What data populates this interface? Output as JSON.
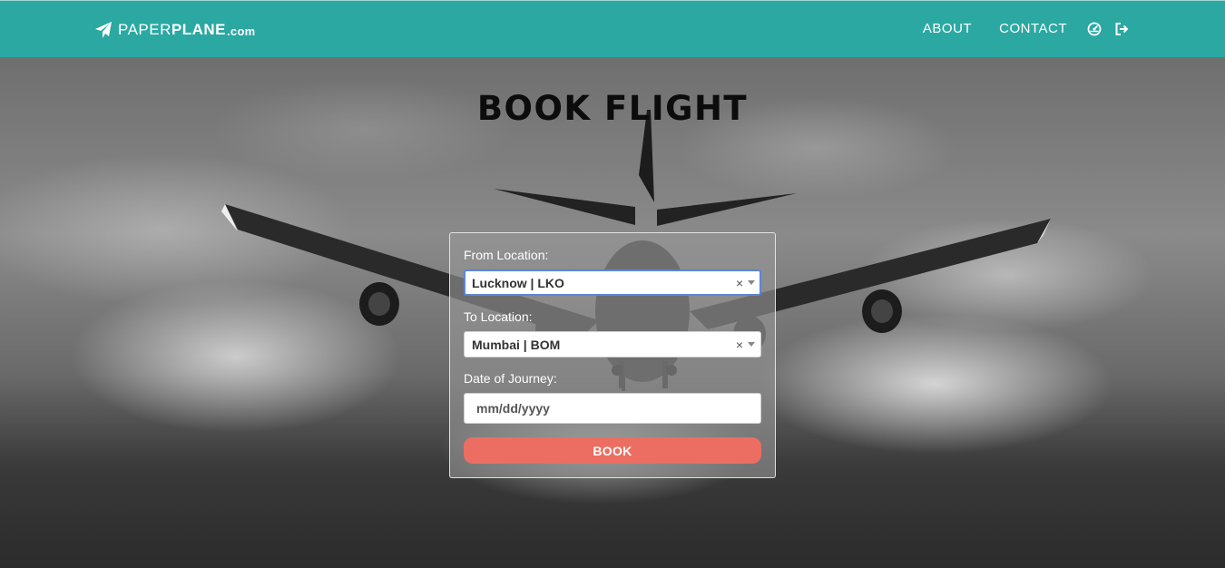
{
  "brand": {
    "light": "PAPER",
    "bold": "PLANE",
    "tld": ".com",
    "icon": "paper-plane-icon"
  },
  "nav": {
    "links": [
      {
        "label": "ABOUT"
      },
      {
        "label": "CONTACT"
      }
    ],
    "icons": [
      "dashboard-icon",
      "sign-out-icon"
    ]
  },
  "colors": {
    "navbar": "#2ba8a2",
    "book_button": "#ec6e62",
    "focus_border": "#5b86d6"
  },
  "page": {
    "title": "BOOK FLIGHT"
  },
  "form": {
    "from_label": "From Location:",
    "from_value": "Lucknow | LKO",
    "to_label": "To Location:",
    "to_value": "Mumbai | BOM",
    "date_label": "Date of Journey:",
    "date_placeholder": "mm/dd/yyyy",
    "clear_symbol": "×",
    "book_label": "BOOK"
  }
}
